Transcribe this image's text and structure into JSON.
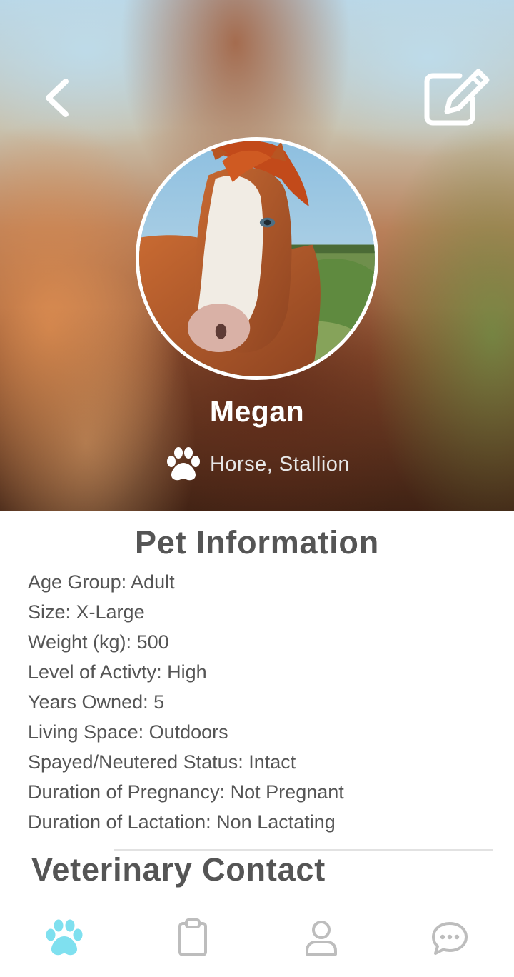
{
  "profile": {
    "name": "Megan",
    "species": "Horse, Stallion"
  },
  "info": {
    "title": "Pet Information",
    "items": [
      "Age Group: Adult",
      "Size: X-Large",
      "Weight (kg): 500",
      "Level of Activty: High",
      "Years Owned: 5",
      "Living Space: Outdoors",
      "Spayed/Neutered Status: Intact",
      "Duration of Pregnancy: Not Pregnant",
      "Duration of Lactation: Non Lactating"
    ]
  },
  "vet": {
    "title": "Veterinary Contact"
  },
  "icons": {
    "back": "chevron-left-icon",
    "edit": "edit-icon",
    "species": "paw-icon"
  },
  "tabs": [
    {
      "icon": "paw-icon",
      "active": true
    },
    {
      "icon": "clipboard-icon",
      "active": false
    },
    {
      "icon": "user-icon",
      "active": false
    },
    {
      "icon": "chat-bubble-icon",
      "active": false
    }
  ],
  "colors": {
    "text": "#555555",
    "accent": "#7fe0ef",
    "tab_inactive": "#bdbdbd"
  }
}
